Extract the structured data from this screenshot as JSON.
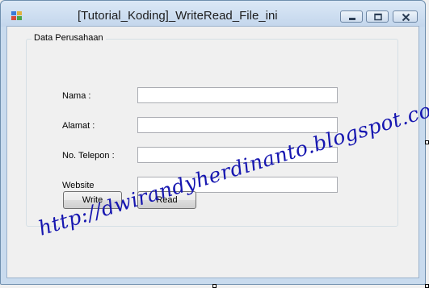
{
  "window": {
    "title": "[Tutorial_Koding]_WriteRead_File_ini",
    "icons": [
      "app-icon",
      "minimize-icon",
      "maximize-icon",
      "close-icon"
    ]
  },
  "group": {
    "title": "Data Perusahaan",
    "fields": [
      {
        "label": "Nama :",
        "value": ""
      },
      {
        "label": "Alamat :",
        "value": ""
      },
      {
        "label": "No. Telepon :",
        "value": ""
      },
      {
        "label": "Website",
        "value": ""
      }
    ]
  },
  "buttons": {
    "write": "Write",
    "read": "Read"
  },
  "watermark": "http://dwirandyherdinanto.blogspot.com/"
}
